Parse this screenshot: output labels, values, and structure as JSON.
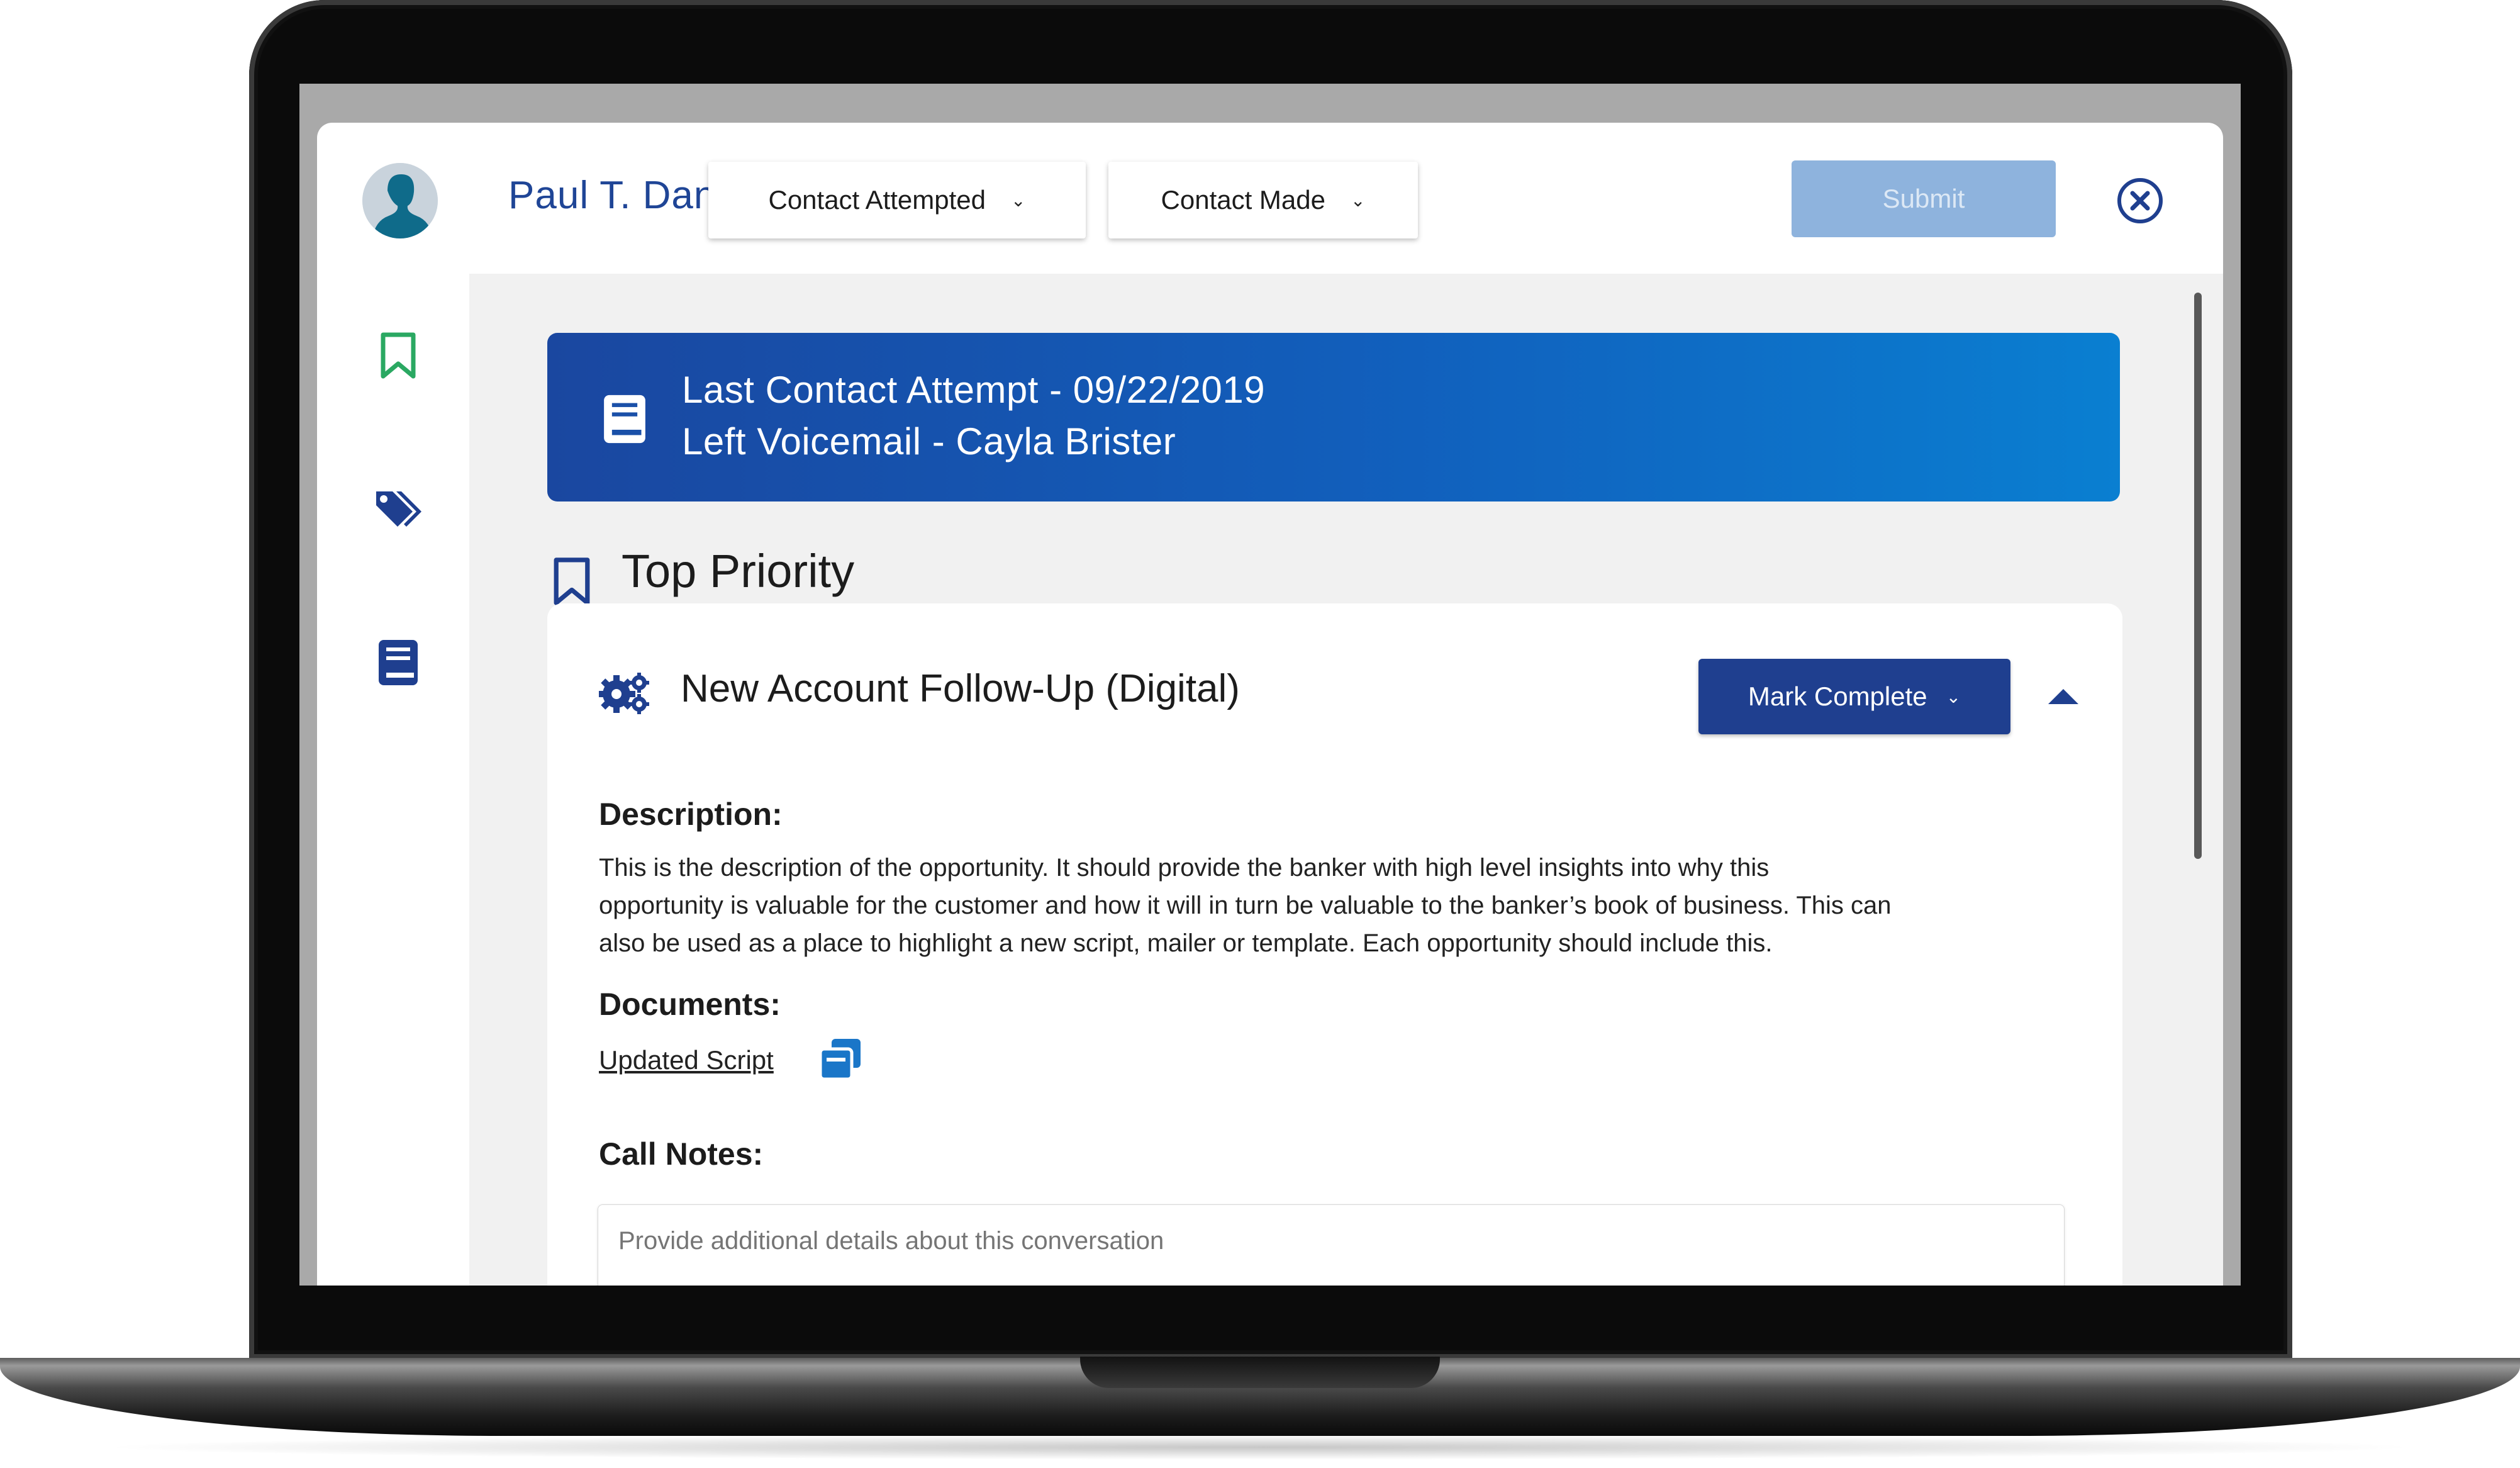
{
  "header": {
    "user_name": "Paul T. Dano",
    "dropdown_contact_attempted": "Contact Attempted",
    "dropdown_contact_made": "Contact Made",
    "submit_label": "Submit"
  },
  "banner": {
    "line1": "Last Contact Attempt - 09/22/2019",
    "line2": "Left Voicemail - Cayla Brister"
  },
  "section": {
    "title": "Top Priority"
  },
  "opportunity": {
    "title": "New Account Follow-Up (Digital)",
    "mark_complete_label": "Mark Complete",
    "description_label": "Description:",
    "description_lines": [
      "This is the description of the opportunity. It should provide the banker with high level insights into why this",
      "opportunity is valuable for the customer and how it will in turn be valuable to the banker’s book of business. This can",
      "also be used as a place to highlight a new script, mailer or template. Each opportunity should include this."
    ],
    "documents_label": "Documents:",
    "document_link": "Updated Script",
    "call_notes_label": "Call Notes:",
    "call_notes_placeholder": "Provide additional details about this conversation"
  },
  "colors": {
    "brand_blue": "#1f4596",
    "banner_start": "#1a47a0",
    "banner_end": "#0a7fd1",
    "bookmark_green": "#2aa862",
    "submit_disabled": "#8eb3dd"
  },
  "icons": {
    "avatar": "user-avatar-icon",
    "close": "close-circle-icon",
    "sidebar": [
      "bookmark-icon",
      "tag-icon",
      "book-icon"
    ],
    "banner": "book-icon",
    "section": "bookmark-icon",
    "opportunity": "gears-icon",
    "collapse": "caret-up-icon",
    "document": "copy-icon",
    "dropdown": "chevron-down-icon"
  }
}
